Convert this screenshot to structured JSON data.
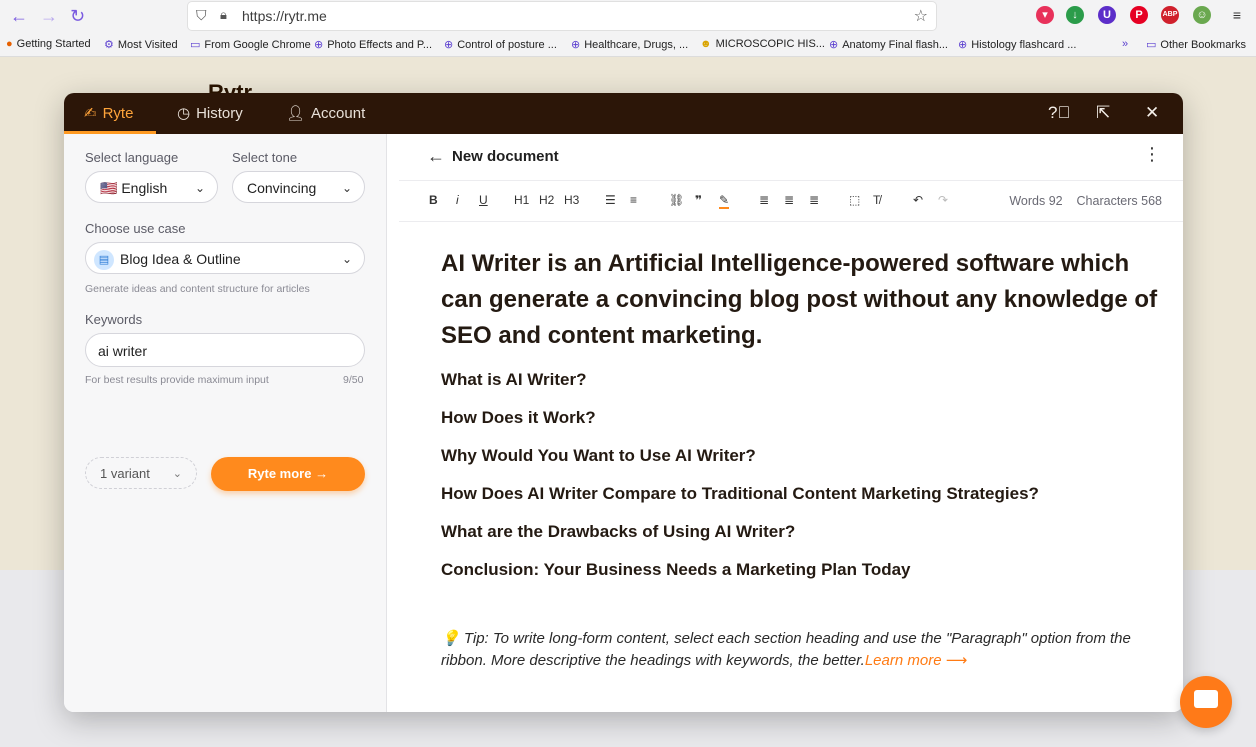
{
  "browser": {
    "url": "https://rytr.me",
    "bookmarks": [
      "Getting Started",
      "Most Visited",
      "From Google Chrome",
      "Photo Effects and P...",
      "Control of posture ...",
      "Healthcare, Drugs, ...",
      "MICROSCOPIC HIS...",
      "Anatomy Final flash...",
      "Histology flashcard ...",
      "Other Bookmarks"
    ]
  },
  "site": {
    "logo": "Rytr"
  },
  "tabs": [
    {
      "label": "Ryte",
      "icon": "writing-hand-icon",
      "active": true
    },
    {
      "label": "History",
      "icon": "clock-icon",
      "active": false
    },
    {
      "label": "Account",
      "icon": "user-icon",
      "active": false
    }
  ],
  "left": {
    "language_label": "Select language",
    "language_value": "🇺🇸 English",
    "tone_label": "Select tone",
    "tone_value": "Convincing",
    "usecase_label": "Choose use case",
    "usecase_value": "Blog Idea & Outline",
    "usecase_hint": "Generate ideas and content structure for articles",
    "keywords_label": "Keywords",
    "keywords_value": "ai writer",
    "keywords_hint": "For best results provide maximum input",
    "keywords_count": "9/50",
    "variant_value": "1 variant",
    "ryte_button": "Ryte more →"
  },
  "doc": {
    "title": "New document",
    "words": "Words 92",
    "characters": "Characters 568",
    "heading": "AI Writer is an Artificial Intelligence-powered software which can generate a convincing blog post without any knowledge of SEO and content marketing.",
    "sections": [
      "What is AI Writer?",
      "How Does it Work?",
      "Why Would You Want to Use AI Writer?",
      "How Does AI Writer Compare to Traditional Content Marketing Strategies?",
      "What are the Drawbacks of Using AI Writer?",
      "Conclusion: Your Business Needs a Marketing Plan Today"
    ],
    "tip": "💡 Tip: To write long-form content, select each section heading and use the \"Paragraph\" option from the ribbon. More descriptive the headings with keywords, the better.",
    "learn_more": "Learn more ⟶"
  },
  "toolbar": {
    "bold": "B",
    "italic": "i",
    "underline": "U",
    "h1": "H1",
    "h2": "H2",
    "h3": "H3"
  },
  "colors": {
    "header": "#2c1608",
    "accent": "#ff8a1d"
  }
}
